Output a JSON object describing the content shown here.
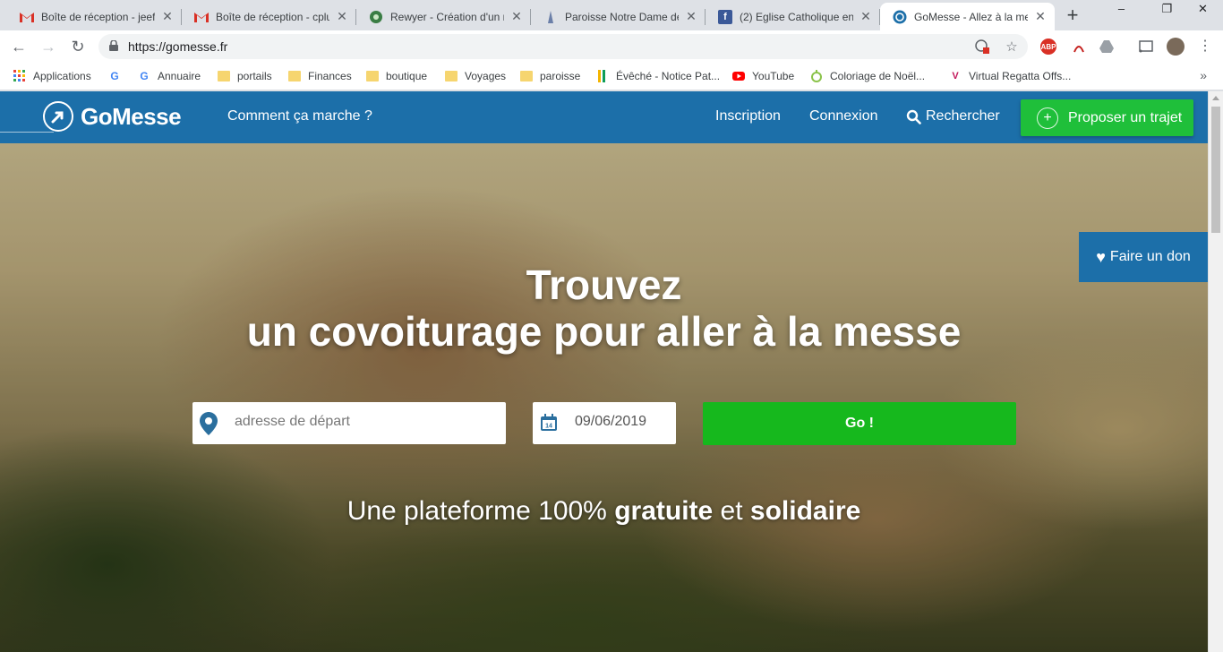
{
  "browser": {
    "tabs": [
      {
        "title": "Boîte de réception - jeef",
        "favicon": "gmail-icon",
        "active": false
      },
      {
        "title": "Boîte de réception - cplu",
        "favicon": "gmail-icon",
        "active": false
      },
      {
        "title": "Rewyer - Création d'un n",
        "favicon": "rewyer-icon",
        "active": false
      },
      {
        "title": "Paroisse Notre Dame de",
        "favicon": "paroisse-icon",
        "active": false
      },
      {
        "title": "(2) Eglise Catholique en",
        "favicon": "facebook-icon",
        "active": false
      },
      {
        "title": "GoMesse - Allez à la me",
        "favicon": "gomesse-icon",
        "active": true
      }
    ],
    "new_tab_label": "+",
    "url": "https://gomesse.fr",
    "bookmarks": [
      {
        "label": "Applications",
        "icon": "apps-grid-icon"
      },
      {
        "label": "",
        "icon": "google-icon"
      },
      {
        "label": "Annuaire",
        "icon": "google-icon"
      },
      {
        "label": "portails",
        "icon": "folder-icon"
      },
      {
        "label": "Finances",
        "icon": "folder-icon"
      },
      {
        "label": "boutique",
        "icon": "folder-icon"
      },
      {
        "label": "Voyages",
        "icon": "folder-icon"
      },
      {
        "label": "paroisse",
        "icon": "folder-icon"
      },
      {
        "label": "Évêché - Notice Pat...",
        "icon": "eveche-icon"
      },
      {
        "label": "YouTube",
        "icon": "youtube-icon"
      },
      {
        "label": "Coloriage de Noël...",
        "icon": "coloriage-icon"
      },
      {
        "label": "Virtual Regatta Offs...",
        "icon": "virtual-regatta-icon"
      }
    ],
    "bookmarks_more": "»",
    "extensions": {
      "abp": "ABP"
    }
  },
  "site": {
    "logo_text": "GoMesse",
    "nav": {
      "how_it_works": "Comment ça marche ?",
      "signup": "Inscription",
      "login": "Connexion",
      "search": "Rechercher",
      "propose": "Proposer un trajet",
      "propose_plus": "+"
    },
    "colors": {
      "header_blue": "#1c6fa9",
      "green": "#16b81d"
    },
    "hero": {
      "title_line1": "Trouvez",
      "title_line2": "un covoiturage pour aller à la messe",
      "address_placeholder": "adresse de départ",
      "date_value": "09/06/2019",
      "calendar_day": "14",
      "go_label": "Go !",
      "tagline_part1": "Une plateforme 100% ",
      "tagline_bold1": "gratuite",
      "tagline_part2": " et ",
      "tagline_bold2": "solidaire"
    },
    "donate_label": "Faire un don"
  }
}
